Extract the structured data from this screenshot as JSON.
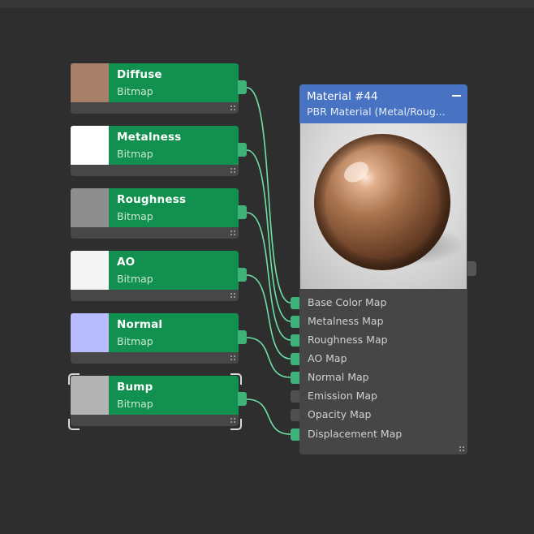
{
  "colors": {
    "canvas_background": "#2e2e2e",
    "map_node_header": "#11904f",
    "material_node_header": "#4773c2",
    "connected_port": "#3fb27a",
    "wire": "#6fe0a6"
  },
  "map_nodes": [
    {
      "title": "Diffuse",
      "subtitle": "Bitmap",
      "swatch_color": "#a8806a",
      "selected": false
    },
    {
      "title": "Metalness",
      "subtitle": "Bitmap",
      "swatch_color": "#ffffff",
      "selected": false
    },
    {
      "title": "Roughness",
      "subtitle": "Bitmap",
      "swatch_color": "#8e8e8e",
      "selected": false
    },
    {
      "title": "AO",
      "subtitle": "Bitmap",
      "swatch_color": "#f4f4f4",
      "selected": false
    },
    {
      "title": "Normal",
      "subtitle": "Bitmap",
      "swatch_color": "#b9bbff",
      "selected": false
    },
    {
      "title": "Bump",
      "subtitle": "Bitmap",
      "swatch_color": "#b3b3b3",
      "selected": true
    }
  ],
  "material_node": {
    "title": "Material #44",
    "subtitle": "PBR Material (Metal/Roug...",
    "collapse_icon": "minus-icon",
    "preview": "copper-sphere-preview",
    "slots": [
      {
        "label": "Base Color Map",
        "connected": true
      },
      {
        "label": "Metalness Map",
        "connected": true
      },
      {
        "label": "Roughness Map",
        "connected": true
      },
      {
        "label": "AO Map",
        "connected": true
      },
      {
        "label": "Normal Map",
        "connected": true
      },
      {
        "label": "Emission Map",
        "connected": false
      },
      {
        "label": "Opacity Map",
        "connected": false
      },
      {
        "label": "Displacement Map",
        "connected": true
      }
    ]
  }
}
